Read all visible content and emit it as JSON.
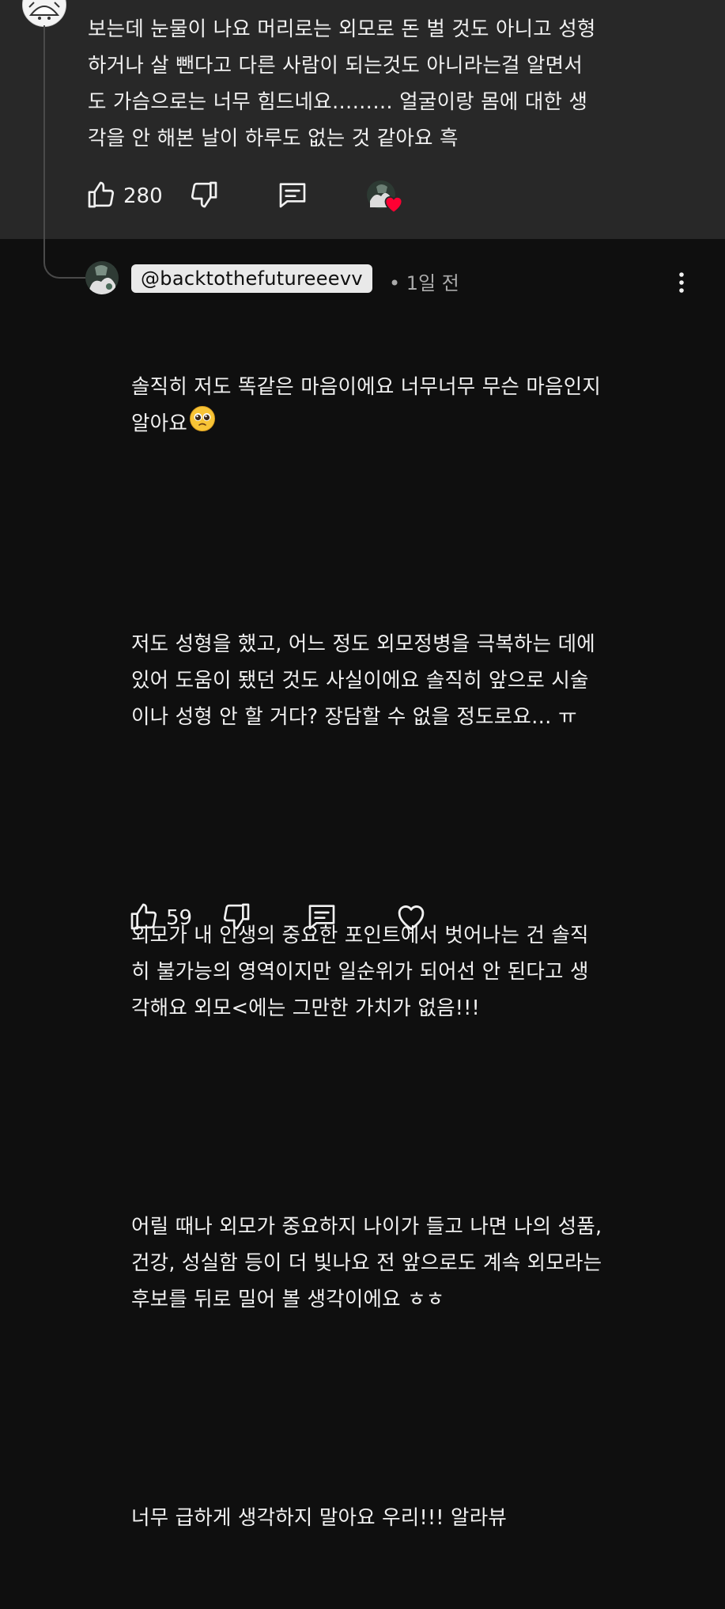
{
  "parent_comment": {
    "text": "보는데 눈물이 나요 머리로는 외모로 돈 벌 것도 아니고 성형\n하거나 살 뺀다고 다른 사람이 되는것도 아니라는걸 알면서\n도 가슴으로는 너무 힘드네요……… 얼굴이랑 몸에 대한 생\n각을 안 해본 날이 하루도 없는 것 같아요 흑",
    "like_count": "280"
  },
  "reply": {
    "handle": "@backtothefutureeevv",
    "time": "• 1일 전",
    "paragraphs": [
      "솔직히 저도 똑같은 마음이에요 너무너무 무슨 마음인지\n알아요",
      "저도 성형을 했고, 어느 정도 외모정병을 극복하는 데에\n있어 도움이 됐던 것도 사실이에요 솔직히 앞으로 시술\n이나 성형 안 할 거다? 장담할 수 없을 정도로요… ㅠ",
      "외모가 내 인생의 중요한 포인트에서 벗어나는 건 솔직\n히 불가능의 영역이지만 일순위가 되어선 안 된다고 생\n각해요 외모<에는 그만한 가치가 없음!!!",
      "어릴 때나 외모가 중요하지 나이가 들고 나면 나의 성품,\n건강, 성실함 등이 더 빛나요 전 앞으로도 계속 외모라는\n후보를 뒤로 밀어 볼 생각이에요 ㅎㅎ",
      "너무 급하게 생각하지 말아요 우리!!! 알라뷰"
    ],
    "like_count": "59"
  },
  "icons": {
    "like": "thumbs-up-icon",
    "dislike": "thumbs-down-icon",
    "reply": "comment-icon",
    "heart": "heart-icon",
    "more": "more-vert-icon",
    "emoji": "pleading-face-emoji"
  },
  "colors": {
    "parent_bg": "#282828",
    "page_bg": "#0f0f0f",
    "text": "#f1f1f1",
    "muted": "#aaaaaa",
    "heart": "#ff0033"
  }
}
